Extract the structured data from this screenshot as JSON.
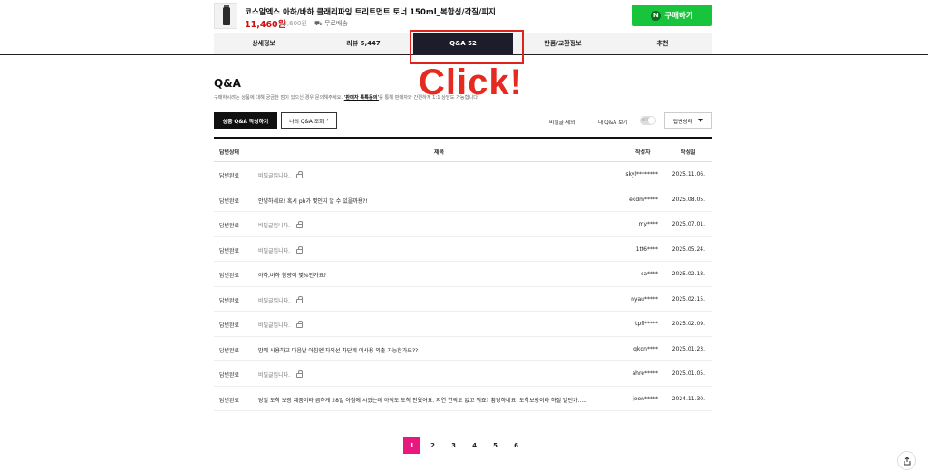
{
  "product": {
    "title": "코스알엑스 아하/바하 클래리파잉 트리트먼트 토너 150ml_복합성/각질/피지",
    "price": "11,460원",
    "original_price": "12,600원",
    "shipping": "무료배송",
    "buy_label": "구매하기",
    "buy_icon": "N"
  },
  "tabs": [
    {
      "label": "상세정보"
    },
    {
      "label": "리뷰 5,447"
    },
    {
      "label": "Q&A 52"
    },
    {
      "label": "반품/교환정보"
    },
    {
      "label": "추천"
    }
  ],
  "annotation": {
    "text": "Click!"
  },
  "qa": {
    "title": "Q&A",
    "desc_prefix": "구매하시려는 상품에 대해 궁금한 점이 있으신 경우 문의해주세요. ",
    "desc_link": "'판매자 톡톡문의'",
    "desc_suffix": "를 통해 판매자와 간편하게 1:1 상담도 가능합니다.",
    "write_label": "상품 Q&A 작성하기",
    "mine_label": "나의 Q&A 조회",
    "filter_secret": "비밀글 제외",
    "filter_myqa": "내 Q&A 보기",
    "toggle_text": "OFF",
    "status_select": "답변상태"
  },
  "table": {
    "headers": {
      "status": "답변상태",
      "title": "제목",
      "author": "작성자",
      "date": "작성일"
    },
    "rows": [
      {
        "status": "답변완료",
        "title": "비밀글입니다.",
        "secret": true,
        "author": "skyl********",
        "date": "2025.11.06."
      },
      {
        "status": "답변완료",
        "title": "안녕하세요! 혹시 ph가 몇인지 알 수 있을까용?!",
        "secret": false,
        "author": "ekdm*****",
        "date": "2025.08.05."
      },
      {
        "status": "답변완료",
        "title": "비밀글입니다.",
        "secret": true,
        "author": "my****",
        "date": "2025.07.01."
      },
      {
        "status": "답변완료",
        "title": "비밀글입니다.",
        "secret": true,
        "author": "1tt6****",
        "date": "2025.05.24."
      },
      {
        "status": "답변완료",
        "title": "아하,바하 함량이 몇%인가요?",
        "secret": false,
        "author": "sa****",
        "date": "2025.02.18."
      },
      {
        "status": "답변완료",
        "title": "비밀글입니다.",
        "secret": true,
        "author": "nyau*****",
        "date": "2025.02.15."
      },
      {
        "status": "답변완료",
        "title": "비밀글입니다.",
        "secret": true,
        "author": "tpfl*****",
        "date": "2025.02.09."
      },
      {
        "status": "답변완료",
        "title": "밤에 사용하고 다음날 아침엔 자외선 차단제 이사용 외출 가능한가요??",
        "secret": false,
        "author": "qkqn****",
        "date": "2025.01.23."
      },
      {
        "status": "답변완료",
        "title": "비밀글입니다.",
        "secret": true,
        "author": "ahre*****",
        "date": "2025.01.05."
      },
      {
        "status": "답변완료",
        "title": "당일 도착 보장 제품이라 급하게 28일 아침에 시켰는데 아직도 도착 안왔어요. 지연 연락도 없고 뭐죠? 황당하네요. 도착보장이라 하질 말던가.....",
        "secret": false,
        "author": "jeon*****",
        "date": "2024.11.30."
      }
    ]
  },
  "pagination": [
    "1",
    "2",
    "3",
    "4",
    "5",
    "6"
  ],
  "colors": {
    "accent": "#e8197d",
    "buy": "#19c43d",
    "annotation": "#e52a1f",
    "tab_active": "#1c1c2a"
  },
  "icons": {
    "lock": "lock-icon",
    "share": "share-icon",
    "caret": "caret-down-icon",
    "chevron": "chevron-right-icon"
  }
}
